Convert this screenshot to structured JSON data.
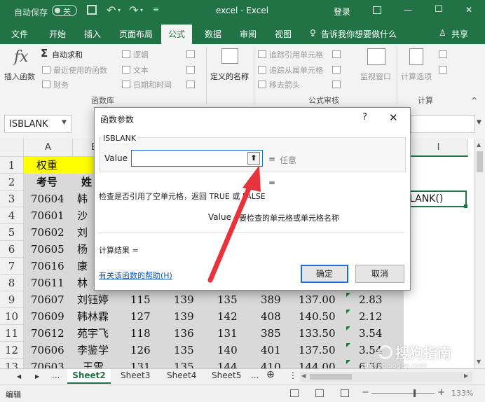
{
  "titlebar": {
    "autosave_label": "自动保存",
    "autosave_state": "关",
    "title": "excel  -  Excel",
    "login": "登录",
    "restore_icon": "ribbon-display-icon",
    "minimize": "—",
    "maximize": "☐",
    "close": "✕"
  },
  "tabs": [
    "文件",
    "开始",
    "插入",
    "页面布局",
    "公式",
    "数据",
    "审阅",
    "视图"
  ],
  "tell_me": "告诉我你想要做什么",
  "share": "共享",
  "ribbon": {
    "insert_function": "插入函数",
    "autosum": "自动求和",
    "recent": "最近使用的函数",
    "finance": "财务",
    "logic": "逻辑",
    "text": "文本",
    "datetime": "日期和时间",
    "group_library": "函数库",
    "defined_names": "定义的名称",
    "trace_precedents": "追踪引用单元格",
    "trace_dependents": "追踪从属单元格",
    "remove_arrows": "移去箭头",
    "watch_window": "监视窗口",
    "group_audit": "公式审核",
    "calc_options": "计算选项",
    "group_calc": "计算",
    "collapse": "^"
  },
  "formula_bar": {
    "name_box": "ISBLANK",
    "partial_formula": "LANK()"
  },
  "grid": {
    "columns": [
      "A",
      "B",
      "I"
    ],
    "row_numbers": [
      "1",
      "2",
      "3",
      "4",
      "5",
      "6",
      "7",
      "8",
      "9",
      "10",
      "11",
      "12",
      "13"
    ],
    "row1": "权重",
    "row2": [
      "考号",
      "姓"
    ],
    "col_a": [
      "70604",
      "70601",
      "70602",
      "70605",
      "70616",
      "70611",
      "70607",
      "70609",
      "70612",
      "70606",
      "70603"
    ],
    "col_b": [
      "韩",
      "沙",
      "刘",
      "杨",
      "康",
      "林",
      "刘钰婷",
      "韩林霖",
      "苑宇飞",
      "李鉴学",
      "王雪"
    ],
    "lower_rows": [
      [
        "115",
        "139",
        "135",
        "389",
        "137.00",
        "2.83"
      ],
      [
        "127",
        "139",
        "142",
        "408",
        "140.50",
        "2.12"
      ],
      [
        "118",
        "136",
        "131",
        "385",
        "133.50",
        "3.54"
      ],
      [
        "126",
        "135",
        "140",
        "401",
        "137.50",
        "3.54"
      ],
      [
        "131",
        "135",
        "144",
        "410",
        "144.00",
        "6.36"
      ]
    ]
  },
  "dialog": {
    "title": "函数参数",
    "help": "?",
    "close": "✕",
    "func_name": "ISBLANK",
    "arg_label": "Value",
    "arg_value": "",
    "eq1": "=",
    "result_any": "任意",
    "eq2": "=",
    "description": "检查是否引用了空单元格，返回 TRUE 或 FALSE",
    "arg_desc_name": "Value",
    "arg_desc": "要检查的单元格或单元格名称",
    "calc_result": "计算结果 =",
    "help_link": "有关该函数的帮助(H)",
    "ok": "确定",
    "cancel": "取消"
  },
  "sheets": {
    "nav_prev": "◀",
    "nav_next": "▶",
    "more_left": "...",
    "items": [
      "Sheet2",
      "Sheet3",
      "Sheet4",
      "Sheet5"
    ],
    "more_right": "...",
    "add": "⊕"
  },
  "status": {
    "mode": "编辑",
    "zoom": "133%"
  },
  "watermark": "搜狗指南",
  "watermark_url": "zhinan.sogou.com",
  "colors": {
    "excel_green": "#217346",
    "annotation_red": "#e8323c",
    "dialog_blue_border": "#1a6fd0"
  }
}
